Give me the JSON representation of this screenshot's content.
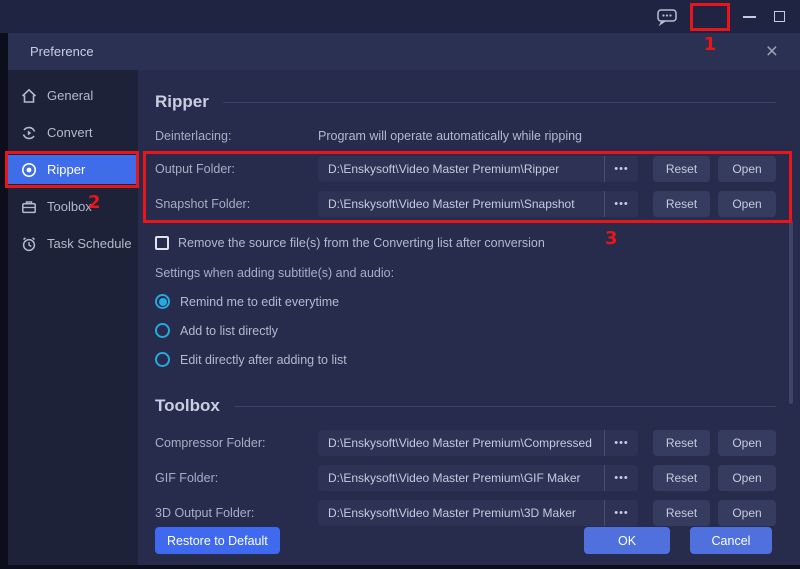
{
  "titlebar": {
    "feedback_icon": "speech-bubble-dots",
    "menu_icon": "hamburger",
    "minimize_icon": "minimize-dash",
    "maximize_icon": "maximize-square"
  },
  "dialog": {
    "title": "Preference",
    "close_icon": "×"
  },
  "sidebar": {
    "items": [
      {
        "label": "General",
        "icon": "home-icon",
        "selected": false
      },
      {
        "label": "Convert",
        "icon": "convert-arrows-icon",
        "selected": false
      },
      {
        "label": "Ripper",
        "icon": "disc-icon",
        "selected": true
      },
      {
        "label": "Toolbox",
        "icon": "briefcase-icon",
        "selected": false
      },
      {
        "label": "Task Schedule",
        "icon": "alarm-clock-icon",
        "selected": false
      }
    ]
  },
  "main": {
    "ripper_section": {
      "heading": "Ripper",
      "deinterlacing_label": "Deinterlacing:",
      "deinterlacing_value": "Program will operate automatically while ripping",
      "folders": [
        {
          "label": "Output Folder:",
          "path": "D:\\Enskysoft\\Video Master Premium\\Ripper"
        },
        {
          "label": "Snapshot Folder:",
          "path": "D:\\Enskysoft\\Video Master Premium\\Snapshot"
        }
      ]
    },
    "remove_checkbox": {
      "label": "Remove the source file(s) from the Converting list after conversion",
      "checked": false
    },
    "subtitle_settings": {
      "label": "Settings when adding subtitle(s) and audio:",
      "options": [
        {
          "label": "Remind me to edit everytime",
          "selected": true
        },
        {
          "label": "Add to list directly",
          "selected": false
        },
        {
          "label": "Edit directly after adding to list",
          "selected": false
        }
      ]
    },
    "toolbox_section": {
      "heading": "Toolbox",
      "folders": [
        {
          "label": "Compressor Folder:",
          "path": "D:\\Enskysoft\\Video Master Premium\\Compressed"
        },
        {
          "label": "GIF Folder:",
          "path": "D:\\Enskysoft\\Video Master Premium\\GIF Maker"
        },
        {
          "label": "3D Output Folder:",
          "path": "D:\\Enskysoft\\Video Master Premium\\3D Maker"
        }
      ]
    },
    "row_buttons": {
      "browse": "•••",
      "reset": "Reset",
      "open": "Open"
    }
  },
  "footer": {
    "restore": "Restore to Default",
    "ok": "OK",
    "cancel": "Cancel"
  },
  "annotations": {
    "step1": "1",
    "step2": "2",
    "step3": "3"
  },
  "colors": {
    "annotation_red": "#e8161a",
    "accent_blue_selected": "#3f6ce8",
    "button_blue": "#4f70dd",
    "restore_blue": "#3f6af0",
    "radio_cyan": "#27a9e0",
    "titlebar_bg": "#1f2443",
    "dialog_bg": "#272c4c",
    "sidebar_bg": "#1d2238",
    "input_bg": "#2e3355"
  }
}
